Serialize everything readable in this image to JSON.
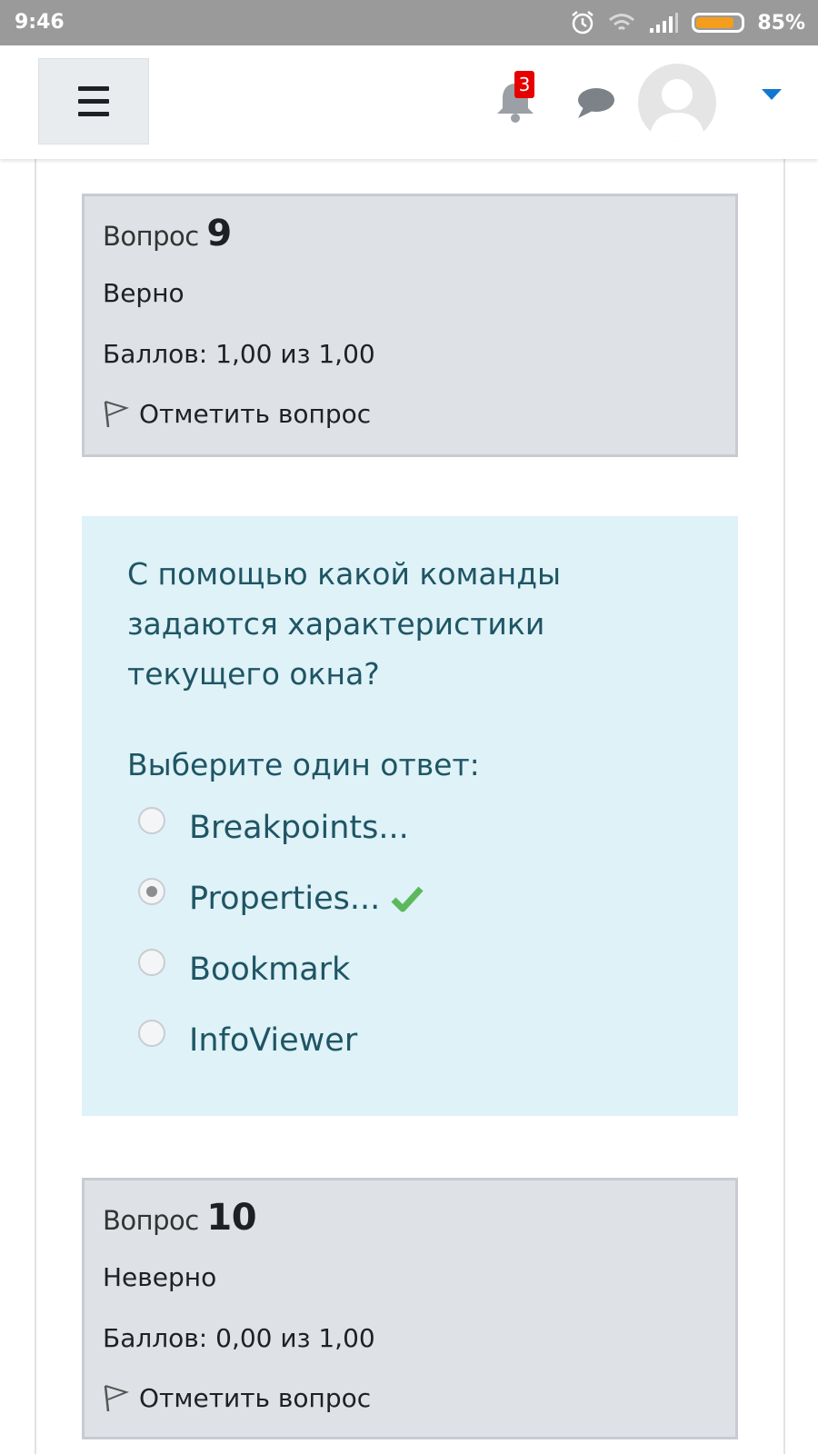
{
  "status_bar": {
    "time": "9:46",
    "battery_percent": "85%",
    "battery_level": 0.85,
    "icons": [
      "alarm-icon",
      "wifi-icon",
      "signal-icon",
      "battery-icon"
    ]
  },
  "header": {
    "menu_icon": "hamburger-icon",
    "notifications": {
      "icon": "bell-icon",
      "count": "3"
    },
    "messages_icon": "chat-icon",
    "user_menu_icon": "caret-down-icon"
  },
  "colors": {
    "info_bg": "#dee2e6",
    "content_bg": "#def2f8",
    "content_text": "#1f5564",
    "correct": "#5cb85c",
    "badge": "#e60000",
    "caret": "#1177d1"
  },
  "questions": [
    {
      "label": "Вопрос",
      "number": "9",
      "state": "Верно",
      "grade": "Баллов: 1,00 из 1,00",
      "flag_label": "Отметить вопрос"
    },
    {
      "label": "Вопрос",
      "number": "10",
      "state": "Неверно",
      "grade": "Баллов: 0,00 из 1,00",
      "flag_label": "Отметить вопрос"
    }
  ],
  "content": {
    "question_text": "С помощью какой команды задаются характеристики текущего окна?",
    "prompt": "Выберите один ответ:",
    "answers": [
      {
        "label": "Breakpoints...",
        "selected": false,
        "correct_mark": false
      },
      {
        "label": "Properties...",
        "selected": true,
        "correct_mark": true
      },
      {
        "label": "Bookmark",
        "selected": false,
        "correct_mark": false
      },
      {
        "label": "InfoViewer",
        "selected": false,
        "correct_mark": false
      }
    ]
  }
}
